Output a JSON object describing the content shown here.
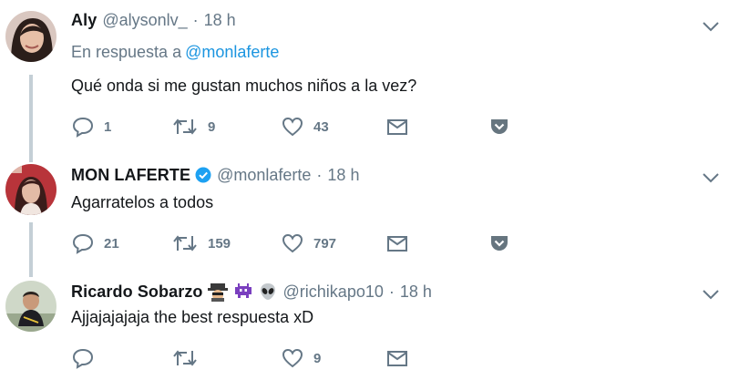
{
  "tweets": [
    {
      "name": "Aly",
      "handle": "@alysonlv_",
      "separator": "·",
      "time": "18 h",
      "reply_prefix": "En respuesta a",
      "reply_mention": "@monlaferte",
      "text": "Qué onda si me gustan muchos niños a la vez?",
      "replies": "1",
      "retweets": "9",
      "likes": "43"
    },
    {
      "name": "MON LAFERTE",
      "verified": true,
      "handle": "@monlaferte",
      "separator": "·",
      "time": "18 h",
      "text": "Agarratelos a todos",
      "replies": "21",
      "retweets": "159",
      "likes": "797"
    },
    {
      "name": "Ricardo Sobarzo",
      "name_emojis": [
        "spy-emoji",
        "space-invader-emoji",
        "alien-emoji"
      ],
      "handle": "@richikapo10",
      "separator": "·",
      "time": "18 h",
      "text": "Ajjajajajaja the best respuesta xD",
      "replies": "",
      "retweets": "",
      "likes": "9"
    }
  ],
  "colors": {
    "text": "#14171a",
    "muted": "#657786",
    "mention": "#1b95e0",
    "verified": "#1da1f2",
    "thread_line": "#c4cfd6"
  },
  "icons": {
    "reply": "reply-icon",
    "retweet": "retweet-icon",
    "like": "heart-icon",
    "dm": "envelope-icon",
    "extra": "pocket-icon",
    "menu": "chevron-down-icon"
  }
}
